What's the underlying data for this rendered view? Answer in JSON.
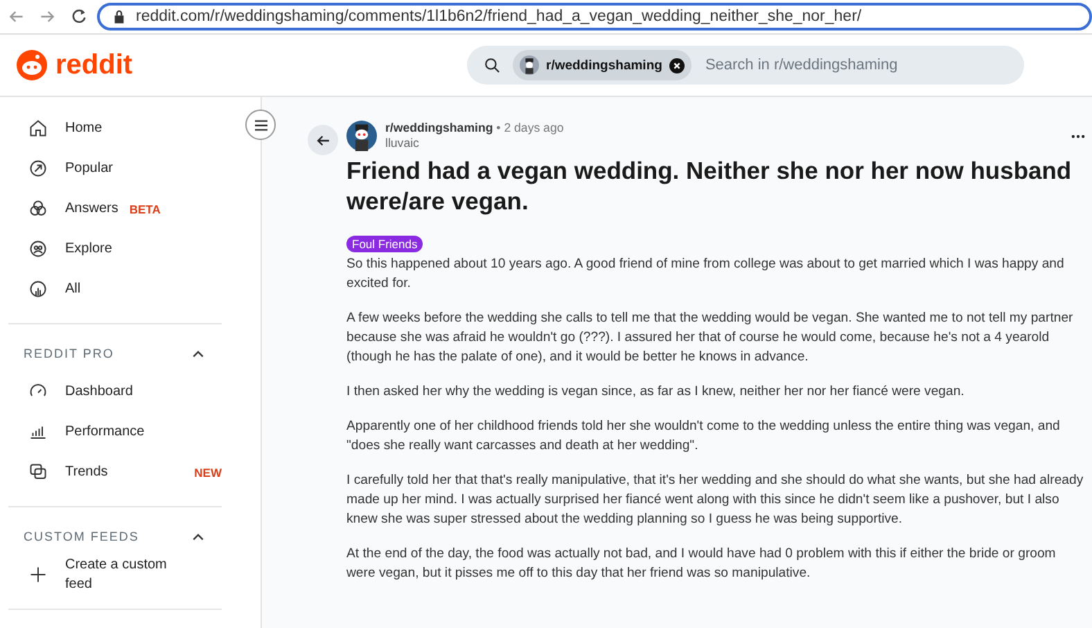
{
  "browser": {
    "url": "reddit.com/r/weddingshaming/comments/1l1b6n2/friend_had_a_vegan_wedding_neither_she_nor_her/"
  },
  "header": {
    "logo": "reddit",
    "search_chip": "r/weddingshaming",
    "placeholder": "Search in r/weddingshaming"
  },
  "sidebar": {
    "items": [
      {
        "label": "Home"
      },
      {
        "label": "Popular"
      },
      {
        "label": "Answers",
        "badge": "BETA"
      },
      {
        "label": "Explore"
      },
      {
        "label": "All"
      }
    ],
    "sections": [
      {
        "title": "REDDIT PRO",
        "expanded": true,
        "items": [
          {
            "label": "Dashboard"
          },
          {
            "label": "Performance"
          },
          {
            "label": "Trends",
            "badge": "NEW"
          }
        ]
      },
      {
        "title": "CUSTOM FEEDS",
        "expanded": true,
        "items": [
          {
            "label": "Create a custom feed"
          }
        ]
      }
    ]
  },
  "post": {
    "subreddit": "r/weddingshaming",
    "time": "• 2 days ago",
    "author": "lluvaic",
    "title": "Friend had a vegan wedding. Neither she nor her now husband were/are vegan.",
    "flair": "Foul Friends",
    "paragraphs": [
      "So this happened about 10 years ago. A good friend of mine from college was about to get married which I was happy and excited for.",
      "A few weeks before the wedding she calls to tell me that the wedding would be vegan. She wanted me to not tell my partner because she was afraid he wouldn't go (???). I assured her that of course he would come, because he's not a 4 yearold (though he has the palate of one), and it would be better he knows in advance.",
      "I then asked her why the wedding is vegan since, as far as I knew, neither her nor her fiancé were vegan.",
      "Apparently one of her childhood friends told her she wouldn't come to the wedding unless the entire thing was vegan, and \"does she really want carcasses and death at her wedding\".",
      "I carefully told her that that's really manipulative, that it's her wedding and she should do what she wants, but she had already made up her mind. I was actually surprised her fiancé went along with this since he didn't seem like a pushover, but I also knew she was super stressed about the wedding planning so I guess he was being supportive.",
      "At the end of the day, the food was actually not bad, and I would have had 0 problem with this if either the bride or groom were vegan, but it pisses me off to this day that her friend was so manipulative."
    ]
  }
}
